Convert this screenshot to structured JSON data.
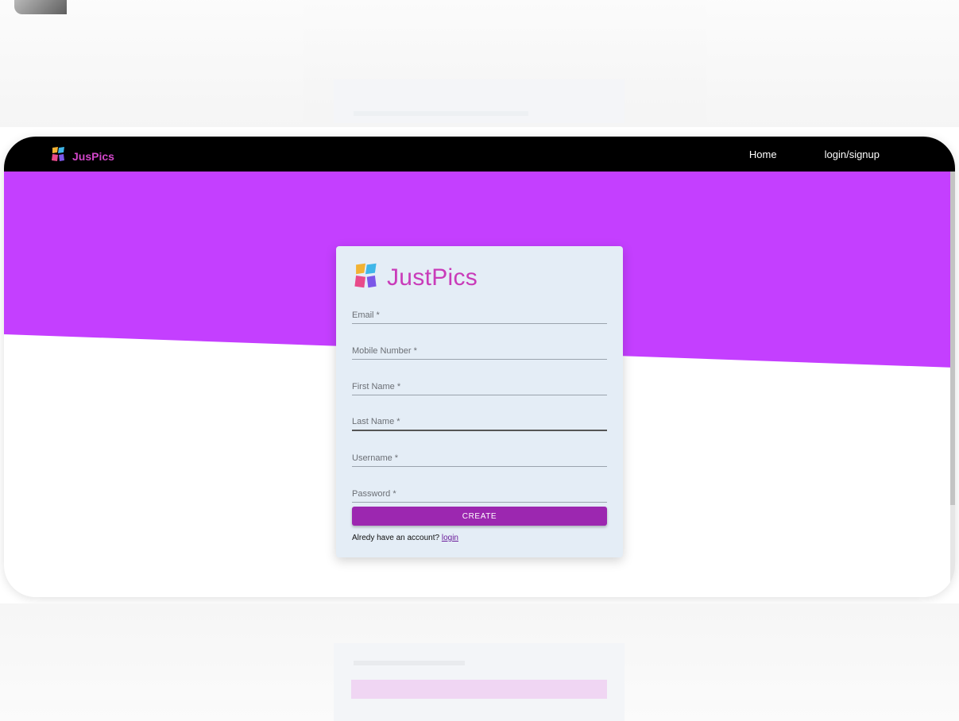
{
  "navbar": {
    "brand_name": "JusPics",
    "links": [
      "Home",
      "login/signup"
    ]
  },
  "card": {
    "title": "JustPics",
    "fields": [
      {
        "label": "Email *"
      },
      {
        "label": "Mobile Number *"
      },
      {
        "label": "First Name *"
      },
      {
        "label": "Last Name *"
      },
      {
        "label": "Username *"
      },
      {
        "label": "Password *"
      }
    ],
    "create_label": "CREATE",
    "account_prompt": "Alredy have an account?",
    "login_link": "login"
  },
  "colors": {
    "navbar_bg": "#000000",
    "hero_purple": "#c43fff",
    "brand_pink": "#d246c9",
    "button_purple": "#9c27b0",
    "card_bg": "#e4edf6"
  },
  "icons": {
    "logo": "justpics-logo-icon"
  }
}
